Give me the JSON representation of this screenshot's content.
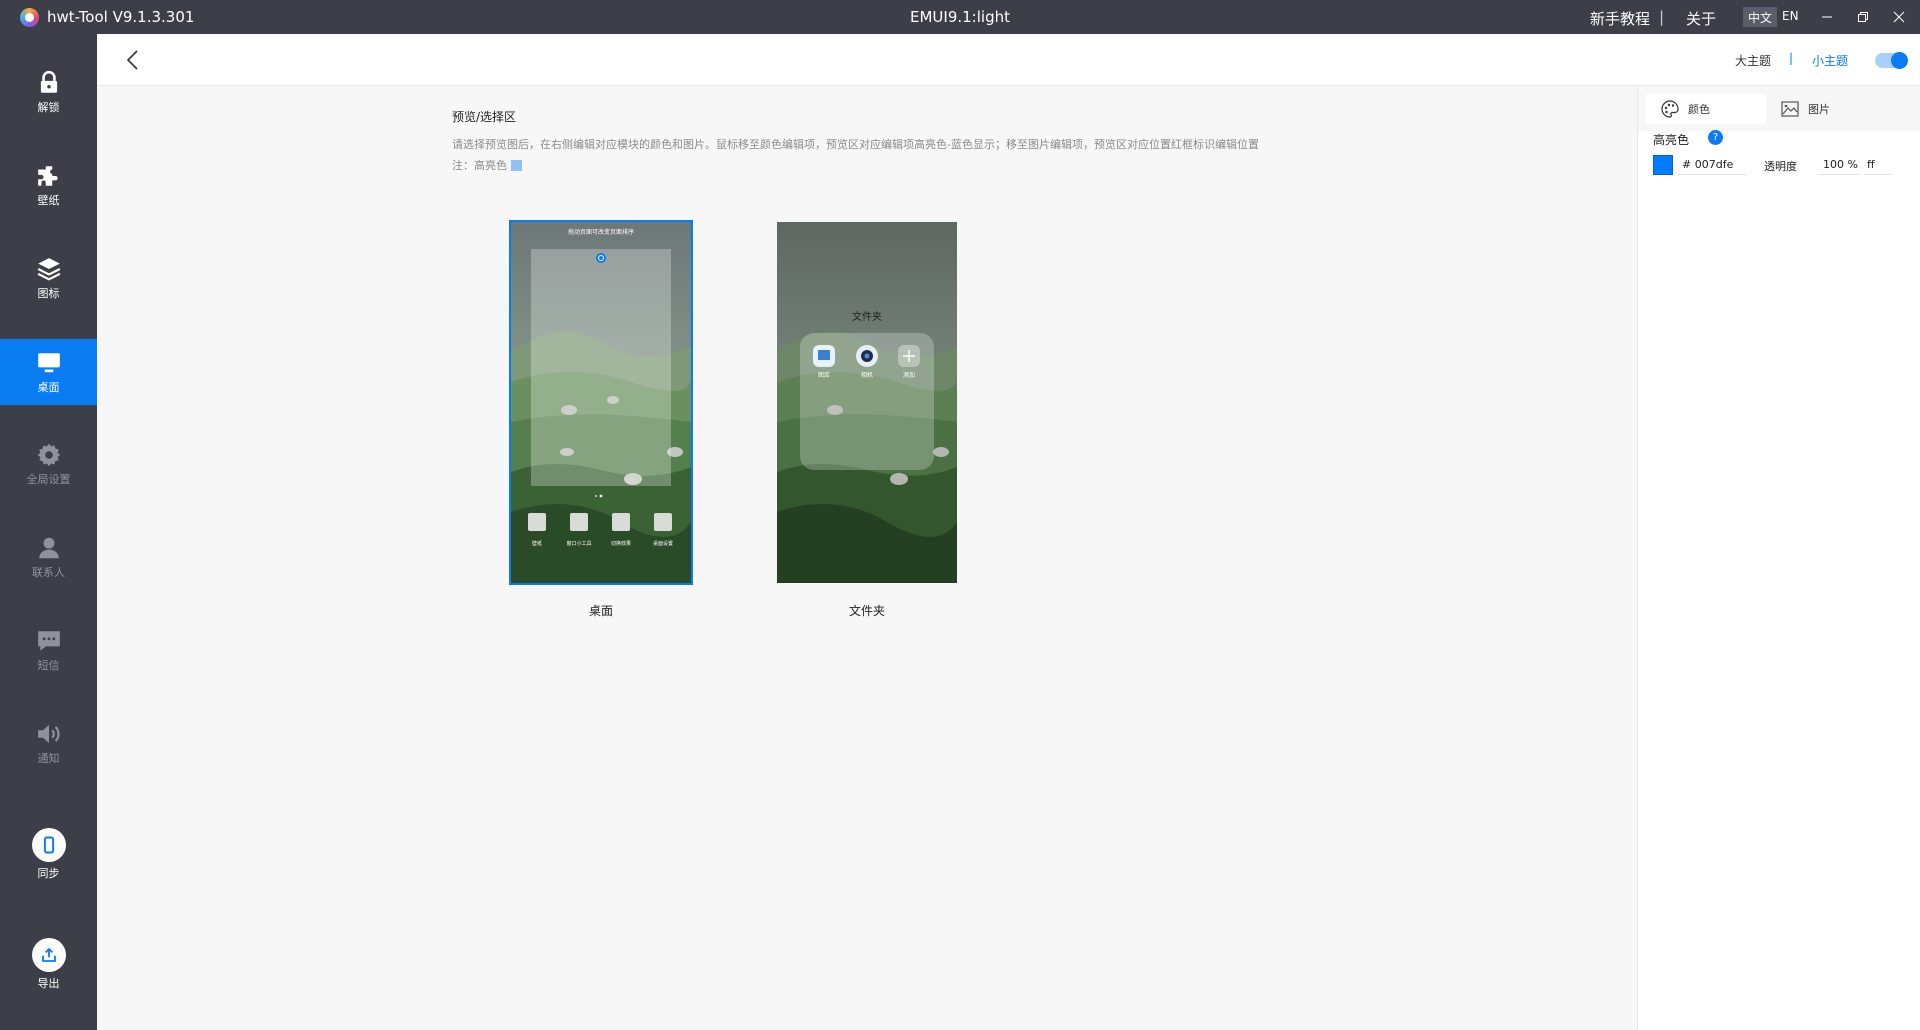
{
  "titlebar": {
    "app_title": "hwt-Tool V9.1.3.301",
    "center_title": "EMUI9.1:light",
    "tutorial": "新手教程",
    "separator": "|",
    "about": "关于",
    "lang_zh": "中文",
    "lang_en": "EN"
  },
  "sidebar": {
    "items": [
      {
        "label": "解锁",
        "icon": "lock-icon"
      },
      {
        "label": "壁纸",
        "icon": "puzzle-icon"
      },
      {
        "label": "图标",
        "icon": "layers-icon"
      },
      {
        "label": "桌面",
        "icon": "monitor-icon"
      },
      {
        "label": "全局设置",
        "icon": "gear-icon"
      },
      {
        "label": "联系人",
        "icon": "user-icon"
      },
      {
        "label": "短信",
        "icon": "message-icon"
      },
      {
        "label": "通知",
        "icon": "speaker-icon"
      },
      {
        "label": "同步",
        "icon": "phone-icon"
      },
      {
        "label": "导出",
        "icon": "export-icon"
      }
    ]
  },
  "topbar": {
    "big_theme": "大主题",
    "separator": "|",
    "small_theme": "小主题"
  },
  "main": {
    "section_title": "预览/选择区",
    "description": "请选择预览图后，在右侧编辑对应模块的颜色和图片。鼠标移至颜色编辑项，预览区对应编辑项高亮色-蓝色显示；移至图片编辑项，预览区对应位置红框标识编辑位置",
    "note": "注：高亮色",
    "highlight_color": "#8fc3f8",
    "previews": [
      {
        "caption": "桌面",
        "hint": "拖动页面可改变页面排序",
        "dock": [
          "壁纸",
          "窗口小工具",
          "切换效果",
          "桌面设置"
        ]
      },
      {
        "caption": "文件夹",
        "folder_title": "文件夹",
        "apps": [
          "图库",
          "相机",
          "添加"
        ]
      }
    ]
  },
  "right_panel": {
    "tabs": [
      {
        "label": "颜色",
        "icon": "palette-icon"
      },
      {
        "label": "图片",
        "icon": "image-icon"
      }
    ],
    "property_label": "高亮色",
    "help": "?",
    "hex_value": "# 007dfe",
    "opacity_label": "透明度",
    "opacity_value": "100 %",
    "opacity_hex": "ff",
    "swatch_color": "#007dfe"
  },
  "colors": {
    "sidebar_bg": "#3c3f47",
    "accent": "#0a7cf2"
  }
}
